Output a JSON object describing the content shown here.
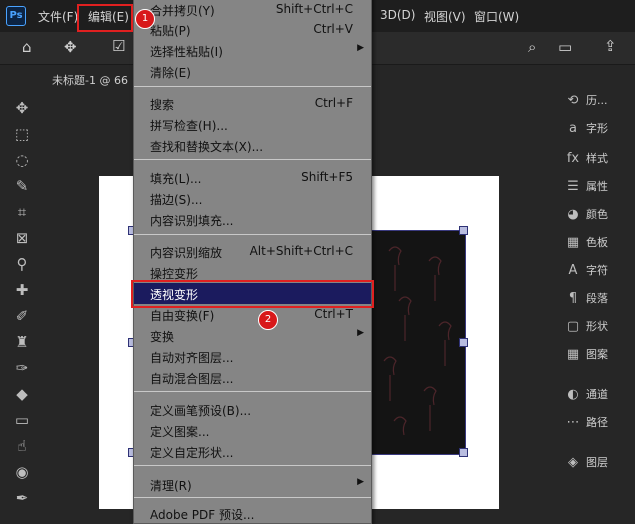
{
  "menubar": {
    "logo": "Ps",
    "items": [
      "文件(F)",
      "编辑(E)",
      "3D(D)",
      "视图(V)",
      "窗口(W)"
    ]
  },
  "document": {
    "tab_title": "未标题-1 @ 66"
  },
  "edit_menu": {
    "items": [
      {
        "label": "合并拷贝(Y)",
        "shortcut": "Shift+Ctrl+C"
      },
      {
        "label": "粘贴(P)",
        "shortcut": "Ctrl+V"
      },
      {
        "label": "选择性粘贴(I)",
        "shortcut": ""
      },
      {
        "label": "清除(E)",
        "shortcut": ""
      },
      {
        "label": "搜索",
        "shortcut": "Ctrl+F"
      },
      {
        "label": "拼写检查(H)...",
        "shortcut": ""
      },
      {
        "label": "查找和替换文本(X)...",
        "shortcut": ""
      },
      {
        "label": "填充(L)...",
        "shortcut": "Shift+F5"
      },
      {
        "label": "描边(S)...",
        "shortcut": ""
      },
      {
        "label": "内容识别填充...",
        "shortcut": ""
      },
      {
        "label": "内容识别缩放",
        "shortcut": "Alt+Shift+Ctrl+C"
      },
      {
        "label": "操控变形",
        "shortcut": ""
      },
      {
        "label": "透视变形",
        "shortcut": ""
      },
      {
        "label": "自由变换(F)",
        "shortcut": "Ctrl+T"
      },
      {
        "label": "变换",
        "shortcut": ""
      },
      {
        "label": "自动对齐图层...",
        "shortcut": ""
      },
      {
        "label": "自动混合图层...",
        "shortcut": ""
      },
      {
        "label": "定义画笔预设(B)...",
        "shortcut": ""
      },
      {
        "label": "定义图案...",
        "shortcut": ""
      },
      {
        "label": "定义自定形状...",
        "shortcut": ""
      },
      {
        "label": "清理(R)",
        "shortcut": ""
      },
      {
        "label": "Adobe PDF 预设...",
        "shortcut": ""
      }
    ]
  },
  "badges": [
    "1",
    "2"
  ],
  "right_panel": {
    "items": [
      "历...",
      "字形",
      "样式",
      "属性",
      "颜色",
      "色板",
      "字符",
      "段落",
      "形状",
      "图案",
      "通道",
      "路径",
      "图层"
    ]
  },
  "colors": {
    "highlight": "#1b1b5e",
    "annotation_red": "#e02020",
    "menu_bg": "#858585"
  }
}
